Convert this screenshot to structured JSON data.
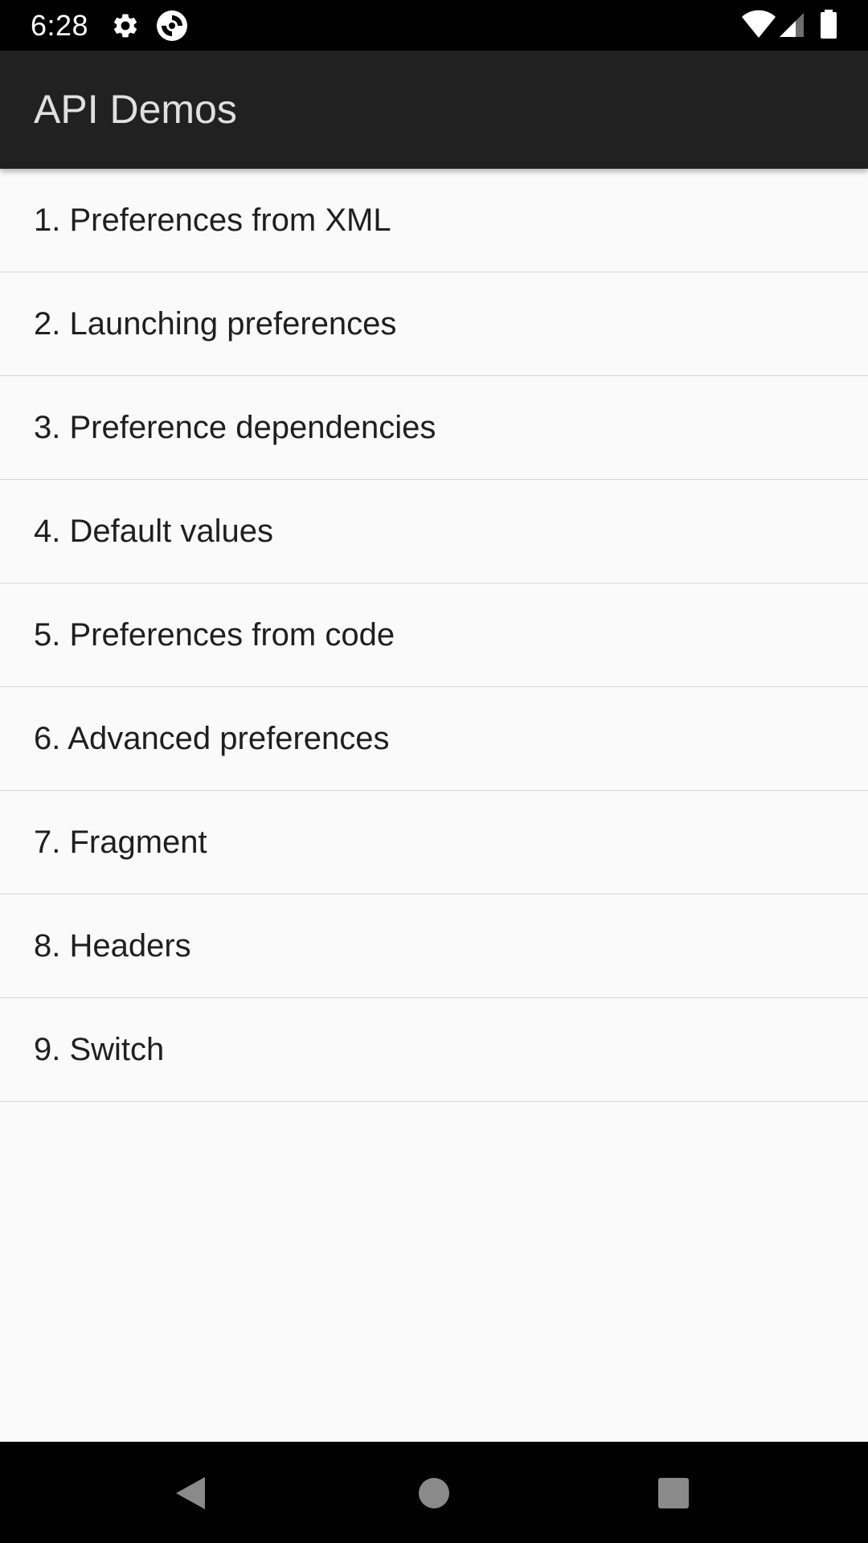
{
  "status_bar": {
    "time": "6:28",
    "icons": [
      "gear-icon",
      "app-notification-icon",
      "wifi-icon",
      "signal-icon",
      "battery-icon"
    ]
  },
  "app_bar": {
    "title": "API Demos"
  },
  "list": {
    "items": [
      {
        "label": "1. Preferences from XML"
      },
      {
        "label": "2. Launching preferences"
      },
      {
        "label": "3. Preference dependencies"
      },
      {
        "label": "4. Default values"
      },
      {
        "label": "5. Preferences from code"
      },
      {
        "label": "6. Advanced preferences"
      },
      {
        "label": "7. Fragment"
      },
      {
        "label": "8. Headers"
      },
      {
        "label": "9. Switch"
      }
    ]
  },
  "nav_bar": {
    "icons": [
      "back-icon",
      "home-icon",
      "recents-icon"
    ]
  },
  "colors": {
    "status_bar": "#000000",
    "app_bar": "#212121",
    "title_text": "#e0e0e0",
    "background": "#fafafa",
    "divider": "#d6d6d6",
    "item_text": "#1f1f1f",
    "nav_bar": "#000000",
    "nav_icons": "#8a8a8a"
  }
}
